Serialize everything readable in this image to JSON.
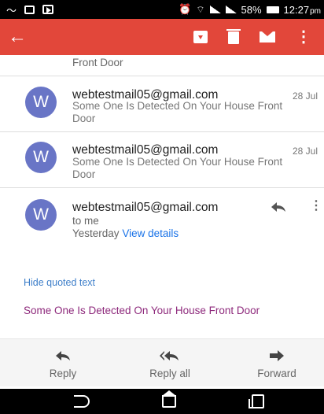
{
  "status_bar": {
    "battery": "58%",
    "time": "12:27",
    "ampm": "pm"
  },
  "toolbar": {
    "back": "←",
    "more": "⋮"
  },
  "thread": {
    "partial_snippet": "Front Door",
    "messages": [
      {
        "avatar_letter": "W",
        "sender": "webtestmail05@gmail.com",
        "date": "28 Jul",
        "snippet": "Some One Is Detected On Your House Front Door"
      },
      {
        "avatar_letter": "W",
        "sender": "webtestmail05@gmail.com",
        "date": "28 Jul",
        "snippet": "Some One Is Detected On Your House Front Door"
      }
    ],
    "expanded": {
      "avatar_letter": "W",
      "sender": "webtestmail05@gmail.com",
      "recipient": "to me",
      "when": "Yesterday",
      "view_details": "View details",
      "hide_quoted": "Hide quoted text",
      "body": "Some One Is Detected On Your House Front Door"
    }
  },
  "actions": {
    "reply": "Reply",
    "reply_all": "Reply all",
    "forward": "Forward"
  },
  "colors": {
    "toolbar": "#e2473a",
    "avatar": "#6975c6",
    "link": "#1a73e8",
    "body_text": "#8e2a7c"
  }
}
